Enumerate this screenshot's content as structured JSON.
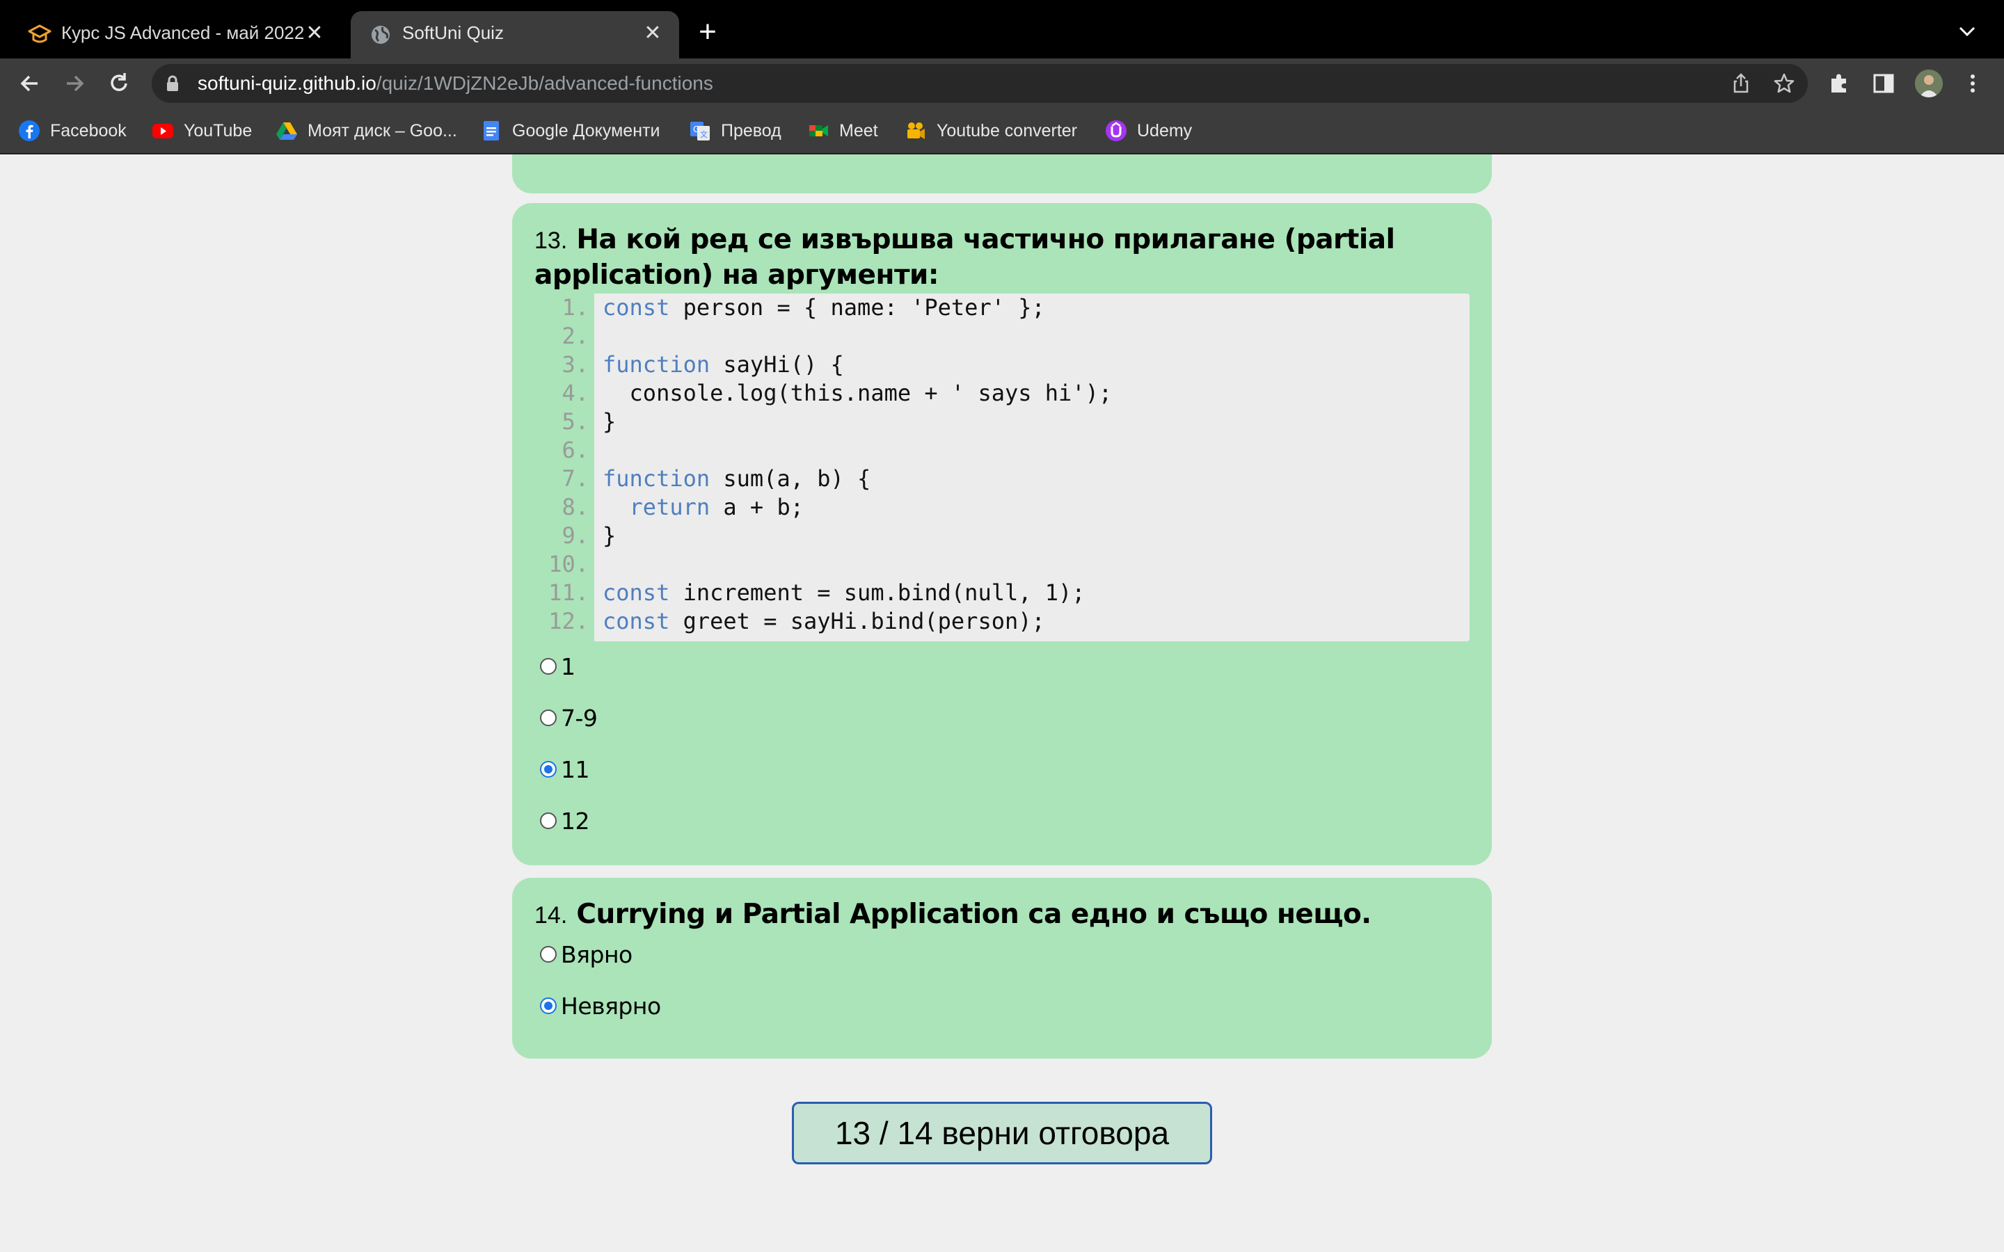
{
  "browser": {
    "tabs": [
      {
        "title": "Курс JS Advanced - май 2022",
        "icon": "graduation-cap-icon",
        "active": false
      },
      {
        "title": "SoftUni Quiz",
        "icon": "globe-icon",
        "active": true
      }
    ],
    "url_host": "softuni-quiz.github.io",
    "url_path": "/quiz/1WDjZN2eJb/advanced-functions",
    "bookmarks": [
      {
        "label": "Facebook",
        "icon": "facebook-icon"
      },
      {
        "label": "YouTube",
        "icon": "youtube-icon"
      },
      {
        "label": "Моят диск – Goo...",
        "icon": "google-drive-icon"
      },
      {
        "label": "Google Документи",
        "icon": "google-docs-icon"
      },
      {
        "label": "Превод",
        "icon": "google-translate-icon"
      },
      {
        "label": "Meet",
        "icon": "google-meet-icon"
      },
      {
        "label": "Youtube converter",
        "icon": "camera-icon"
      },
      {
        "label": "Udemy",
        "icon": "udemy-icon"
      }
    ]
  },
  "quiz": {
    "q13": {
      "number": "13.",
      "title": "На кой ред се извършва частично прилагане (partial application) на аргументи:",
      "code": [
        {
          "n": "1.",
          "kw": "const",
          "rest": " person = { name: 'Peter' };"
        },
        {
          "n": "2.",
          "kw": "",
          "rest": ""
        },
        {
          "n": "3.",
          "kw": "function",
          "rest": " sayHi() {"
        },
        {
          "n": "4.",
          "kw": "",
          "rest": "  console.log(this.name + ' says hi');"
        },
        {
          "n": "5.",
          "kw": "",
          "rest": "}"
        },
        {
          "n": "6.",
          "kw": "",
          "rest": ""
        },
        {
          "n": "7.",
          "kw": "function",
          "rest": " sum(a, b) {"
        },
        {
          "n": "8.",
          "kw": "  return",
          "rest": " a + b;"
        },
        {
          "n": "9.",
          "kw": "",
          "rest": "}"
        },
        {
          "n": "10.",
          "kw": "",
          "rest": ""
        },
        {
          "n": "11.",
          "kw": "const",
          "rest": " increment = sum.bind(null, 1);"
        },
        {
          "n": "12.",
          "kw": "const",
          "rest": " greet = sayHi.bind(person);"
        }
      ],
      "options": [
        {
          "label": "1",
          "checked": false
        },
        {
          "label": "7-9",
          "checked": false
        },
        {
          "label": "11",
          "checked": true
        },
        {
          "label": "12",
          "checked": false
        }
      ]
    },
    "q14": {
      "number": "14.",
      "title": "Currying и Partial Application са едно и също нещо.",
      "options": [
        {
          "label": "Вярно",
          "checked": false
        },
        {
          "label": "Невярно",
          "checked": true
        }
      ]
    },
    "score": "13 / 14 верни отговора"
  },
  "colors": {
    "card": "#aae4b8",
    "keyword": "#4f7fc0",
    "radio_checked": "#1a73e8",
    "score_border": "#2a5db0"
  }
}
